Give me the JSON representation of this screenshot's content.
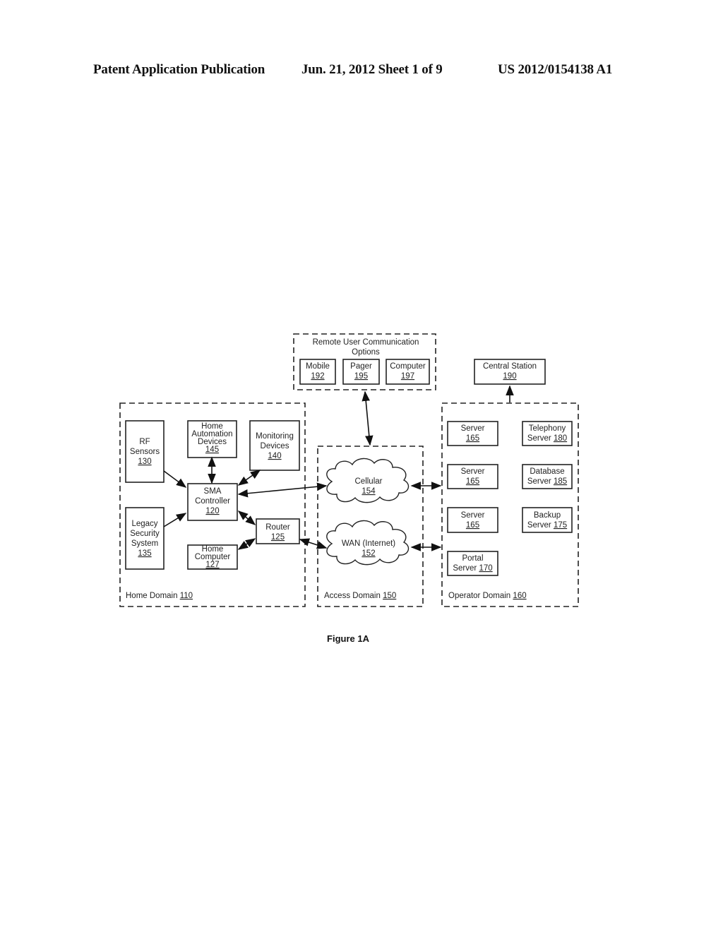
{
  "header": {
    "publication": "Patent Application Publication",
    "date_sheet": "Jun. 21, 2012  Sheet 1 of 9",
    "number": "US 2012/0154138 A1"
  },
  "figure": {
    "caption": "Figure 1A",
    "domains": {
      "home": {
        "label": "Home Domain",
        "ref": "110"
      },
      "access": {
        "label": "Access Domain",
        "ref": "150"
      },
      "operator": {
        "label": "Operator Domain",
        "ref": "160"
      },
      "remote": {
        "title_line1": "Remote User Communication",
        "title_line2": "Options"
      }
    },
    "nodes": {
      "rf_sensors": {
        "lines": [
          "RF",
          "Sensors"
        ],
        "ref": "130"
      },
      "home_automation": {
        "lines": [
          "Home",
          "Automation",
          "Devices"
        ],
        "ref": "145"
      },
      "monitoring": {
        "lines": [
          "Monitoring",
          "Devices"
        ],
        "ref": "140"
      },
      "sma_controller": {
        "lines": [
          "SMA",
          "Controller"
        ],
        "ref": "120"
      },
      "legacy_security": {
        "lines": [
          "Legacy",
          "Security",
          "System"
        ],
        "ref": "135"
      },
      "router": {
        "lines": [
          "Router"
        ],
        "ref": "125"
      },
      "home_computer": {
        "lines": [
          "Home",
          "Computer"
        ],
        "ref": "127"
      },
      "cellular": {
        "lines": [
          "Cellular"
        ],
        "ref": "154"
      },
      "wan": {
        "lines": [
          "WAN (Internet)"
        ],
        "ref": "152"
      },
      "mobile": {
        "lines": [
          "Mobile"
        ],
        "ref": "192"
      },
      "pager": {
        "lines": [
          "Pager"
        ],
        "ref": "195"
      },
      "computer": {
        "lines": [
          "Computer"
        ],
        "ref": "197"
      },
      "central_station": {
        "lines": [
          "Central Station"
        ],
        "ref": "190"
      },
      "server_1": {
        "lines": [
          "Server"
        ],
        "ref": "165"
      },
      "server_2": {
        "lines": [
          "Server"
        ],
        "ref": "165"
      },
      "server_3": {
        "lines": [
          "Server"
        ],
        "ref": "165"
      },
      "telephony_server": {
        "lines": [
          "Telephony"
        ],
        "prefix": "Server ",
        "ref": "180"
      },
      "database_server": {
        "lines": [
          "Database"
        ],
        "prefix": "Server ",
        "ref": "185"
      },
      "backup_server": {
        "lines": [
          "Backup"
        ],
        "prefix": "Server ",
        "ref": "175"
      },
      "portal_server": {
        "lines": [
          "Portal"
        ],
        "prefix": "Server ",
        "ref": "170"
      }
    }
  }
}
